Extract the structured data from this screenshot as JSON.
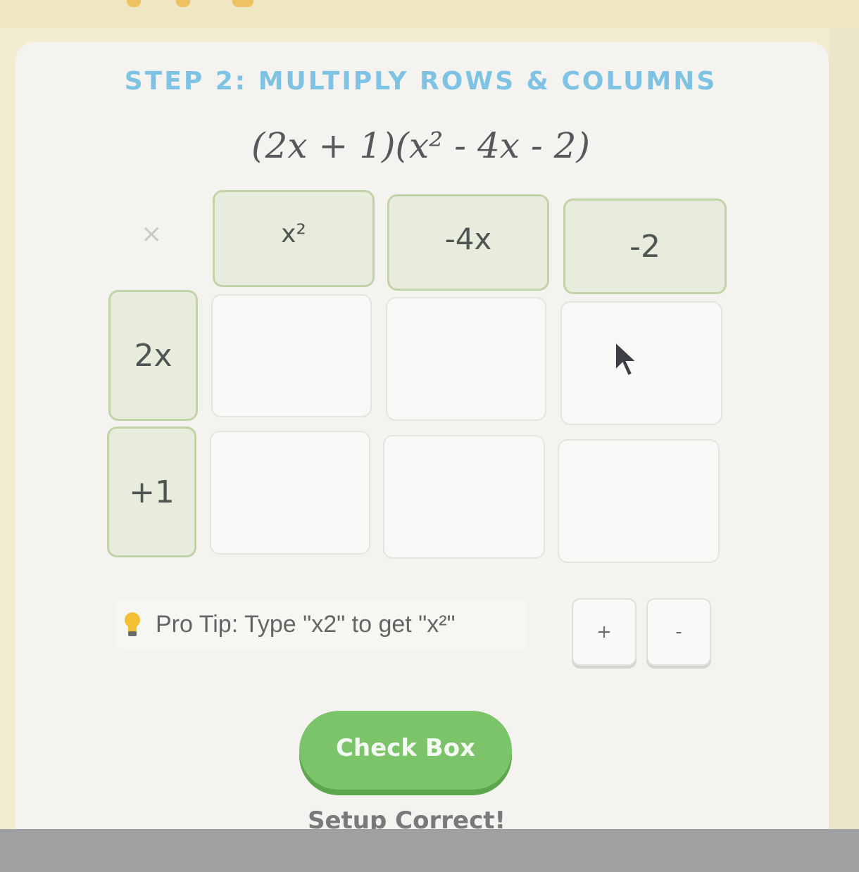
{
  "step_title": "STEP 2: MULTIPLY ROWS & COLUMNS",
  "equation": "(2x + 1)(x² - 4x - 2)",
  "grid": {
    "corner_symbol": "×",
    "column_headers": [
      "x²",
      "-4x",
      "-2"
    ],
    "row_headers": [
      "2x",
      "+1"
    ],
    "cells": [
      [
        "",
        "",
        ""
      ],
      [
        "",
        "",
        ""
      ]
    ]
  },
  "tip": {
    "text": "Pro Tip: Type \"x2\" to get \"x²\"",
    "icon": "lightbulb-icon"
  },
  "controls": {
    "plus_label": "+",
    "minus_label": "-"
  },
  "check_button_label": "Check Box",
  "status_text": "Setup Correct!",
  "colors": {
    "title": "#7ec3e3",
    "header_bg": "#e8ecdd",
    "header_border": "#c3d3a9",
    "button": "#7cc46a"
  }
}
